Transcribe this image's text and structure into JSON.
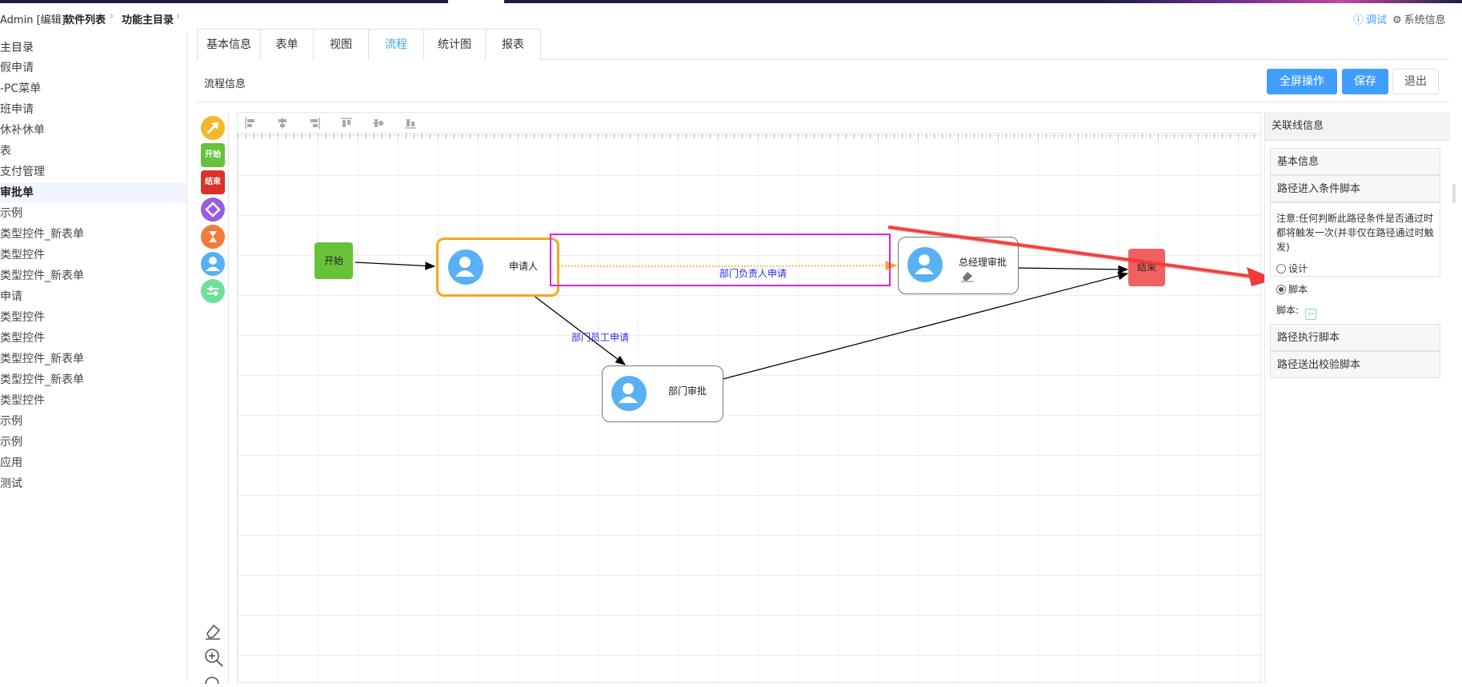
{
  "header": {
    "crumbs": [
      "Admin [编辑]",
      "软件列表",
      "功能主目录"
    ],
    "debug_label": "调试",
    "system_label": "系统信息"
  },
  "sidebar": {
    "items": [
      {
        "label": "主目录"
      },
      {
        "label": "假申请"
      },
      {
        "label": "-PC菜单"
      },
      {
        "label": "班申请"
      },
      {
        "label": "休补休单"
      },
      {
        "label": "表"
      },
      {
        "label": "支付管理"
      },
      {
        "label": "审批单"
      },
      {
        "label": "示例"
      },
      {
        "label": "类型控件_新表单"
      },
      {
        "label": "类型控件"
      },
      {
        "label": "类型控件_新表单"
      },
      {
        "label": "申请"
      },
      {
        "label": "类型控件"
      },
      {
        "label": "类型控件"
      },
      {
        "label": "类型控件_新表单"
      },
      {
        "label": "类型控件_新表单"
      },
      {
        "label": "类型控件"
      },
      {
        "label": "示例"
      },
      {
        "label": "示例"
      },
      {
        "label": "应用"
      },
      {
        "label": "测试"
      }
    ],
    "active_index": 7
  },
  "tabs": [
    "基本信息",
    "表单",
    "视图",
    "流程",
    "统计图",
    "报表"
  ],
  "active_tab": 3,
  "section_title": "流程信息",
  "buttons": {
    "fullscreen": "全屏操作",
    "save": "保存",
    "exit": "退出"
  },
  "palette": {
    "start": "开始",
    "end": "结束"
  },
  "flow": {
    "nodes": {
      "start": "开始",
      "applicant": "申请人",
      "gm_approval": "总经理审批",
      "dept_approval": "部门审批",
      "end": "结束"
    },
    "edges": {
      "dept_head_apply": "部门负责人申请",
      "dept_staff_apply": "部门员工申请"
    }
  },
  "right_panel": {
    "title": "关联线信息",
    "basic_info": "基本信息",
    "entry_script": "路径进入条件脚本",
    "note": "注意:任何判断此路径条件是否通过时都将触发一次(并非仅在路径通过时触发)",
    "radio_design": "设计",
    "radio_script": "脚本",
    "script_label": "脚本:",
    "exec_script": "路径执行脚本",
    "out_script": "路径送出校验脚本",
    "selected": "脚本"
  },
  "colors": {
    "accent": "#409eff",
    "start": "#67c23a",
    "end": "#f06060",
    "selected_node": "#f5a623",
    "highlight_box": "#e020e0",
    "annotation_arrow": "#f03a3a"
  }
}
